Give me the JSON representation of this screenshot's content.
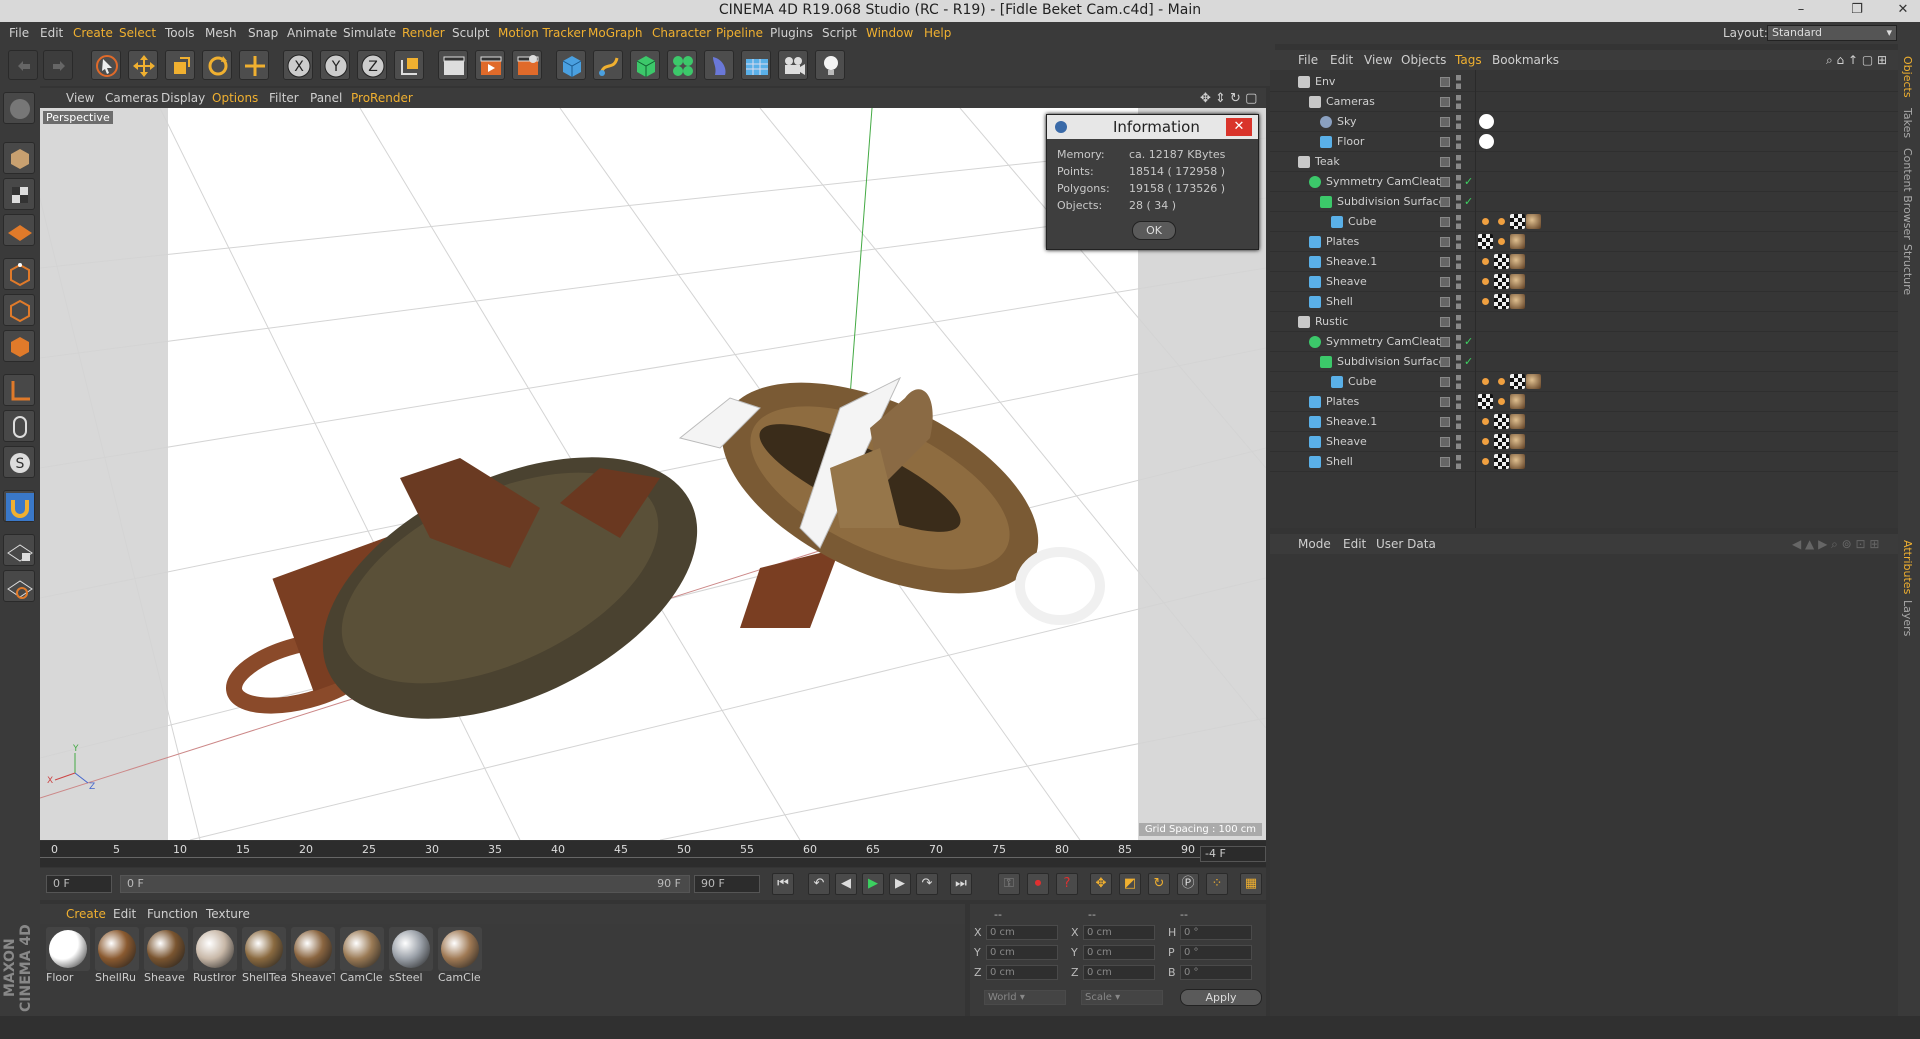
{
  "window": {
    "title": "CINEMA 4D R19.068 Studio (RC - R19) - [Fidle Beket Cam.c4d] - Main"
  },
  "menubar": {
    "items": [
      "File",
      "Edit",
      "Create",
      "Select",
      "Tools",
      "Mesh",
      "Snap",
      "Animate",
      "Simulate",
      "Render",
      "Sculpt",
      "Motion Tracker",
      "MoGraph",
      "Character",
      "Pipeline",
      "Plugins",
      "Script",
      "Window",
      "Help"
    ]
  },
  "layout": {
    "label": "Layout:",
    "value": "Standard"
  },
  "viewport": {
    "menu": [
      "View",
      "Cameras",
      "Display",
      "Options",
      "Filter",
      "Panel",
      "ProRender"
    ],
    "camera_label": "Perspective",
    "grid_spacing": "Grid Spacing : 100 cm"
  },
  "info_dialog": {
    "title": "Information",
    "rows": [
      {
        "label": "Memory:",
        "value": "ca. 12187 KBytes"
      },
      {
        "label": "Points:",
        "value": "18514 ( 172958 )"
      },
      {
        "label": "Polygons:",
        "value": "19158 ( 173526 )"
      },
      {
        "label": "Objects:",
        "value": "28 ( 34 )"
      }
    ],
    "ok": "OK"
  },
  "timeline": {
    "ticks": [
      "0",
      "5",
      "10",
      "15",
      "20",
      "25",
      "30",
      "35",
      "40",
      "45",
      "50",
      "55",
      "60",
      "65",
      "70",
      "75",
      "80",
      "85",
      "90"
    ],
    "current": "-4 F",
    "start": "0 F",
    "range_start": "0 F",
    "range_end": "90 F",
    "end": "90 F"
  },
  "materials": {
    "menu": [
      "Create",
      "Edit",
      "Function",
      "Texture"
    ],
    "items": [
      {
        "name": "Floor",
        "color": "#ffffff"
      },
      {
        "name": "ShellRu",
        "color": "#8a5a30"
      },
      {
        "name": "Sheave",
        "color": "#7a5530"
      },
      {
        "name": "RustIror",
        "color": "#c8b8a8"
      },
      {
        "name": "ShellTea",
        "color": "#8a6a40"
      },
      {
        "name": "SheaveT",
        "color": "#8a6540"
      },
      {
        "name": "CamCle",
        "color": "#9a7a55"
      },
      {
        "name": "sSteel",
        "color": "#9aa0a8"
      },
      {
        "name": "CamCle",
        "color": "#a07a55"
      }
    ]
  },
  "coords": {
    "headers": [
      "--",
      "--",
      "--"
    ],
    "rows": [
      {
        "a": "X",
        "av": "0 cm",
        "b": "X",
        "bv": "0 cm",
        "c": "H",
        "cv": "0 °"
      },
      {
        "a": "Y",
        "av": "0 cm",
        "b": "Y",
        "bv": "0 cm",
        "c": "P",
        "cv": "0 °"
      },
      {
        "a": "Z",
        "av": "0 cm",
        "b": "Z",
        "bv": "0 cm",
        "c": "B",
        "cv": "0 °"
      }
    ],
    "mode": "World",
    "scale": "Scale",
    "apply": "Apply"
  },
  "objects": {
    "menu": [
      "File",
      "Edit",
      "View",
      "Objects",
      "Tags",
      "Bookmarks"
    ],
    "rows": [
      {
        "name": "Env",
        "icon": "null-icon"
      },
      {
        "name": "Cameras",
        "icon": "null-icon"
      },
      {
        "name": "Sky",
        "icon": "sky-icon"
      },
      {
        "name": "Floor",
        "icon": "floor-icon"
      },
      {
        "name": "Teak",
        "icon": "null-icon"
      },
      {
        "name": "Symmetry CamCleat",
        "icon": "symmetry-icon"
      },
      {
        "name": "Subdivision Surface",
        "icon": "subdivision-icon"
      },
      {
        "name": "Cube",
        "icon": "polygon-icon"
      },
      {
        "name": "Plates",
        "icon": "polygon-icon"
      },
      {
        "name": "Sheave.1",
        "icon": "polygon-icon"
      },
      {
        "name": "Sheave",
        "icon": "polygon-icon"
      },
      {
        "name": "Shell",
        "icon": "polygon-icon"
      },
      {
        "name": "Rustic",
        "icon": "null-icon"
      },
      {
        "name": "Symmetry CamCleat",
        "icon": "symmetry-icon"
      },
      {
        "name": "Subdivision Surface",
        "icon": "subdivision-icon"
      },
      {
        "name": "Cube",
        "icon": "polygon-icon"
      },
      {
        "name": "Plates",
        "icon": "polygon-icon"
      },
      {
        "name": "Sheave.1",
        "icon": "polygon-icon"
      },
      {
        "name": "Sheave",
        "icon": "polygon-icon"
      },
      {
        "name": "Shell",
        "icon": "polygon-icon"
      }
    ]
  },
  "attributes": {
    "menu": [
      "Mode",
      "Edit",
      "User Data"
    ]
  },
  "side_tabs": {
    "top": [
      "Objects",
      "Takes",
      "Content Browser",
      "Structure"
    ],
    "bottom": [
      "Attributes",
      "Layers"
    ]
  },
  "brand": {
    "text": "MAXON CINEMA 4D"
  }
}
